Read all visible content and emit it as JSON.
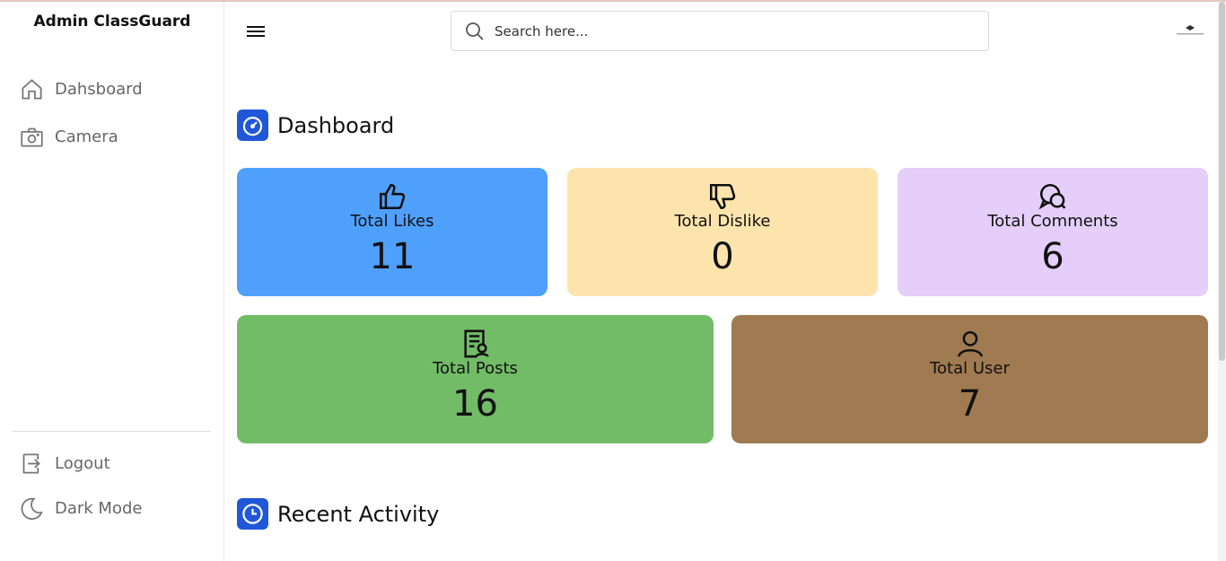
{
  "sidebar": {
    "brand": "Admin ClassGuard",
    "nav": [
      {
        "label": "Dahsboard",
        "icon": "home-icon"
      },
      {
        "label": "Camera",
        "icon": "camera-icon"
      }
    ],
    "bottom": [
      {
        "label": "Logout",
        "icon": "logout-icon"
      },
      {
        "label": "Dark Mode",
        "icon": "moon-icon"
      }
    ]
  },
  "header": {
    "search_placeholder": "Search here..."
  },
  "dashboard": {
    "title": "Dashboard",
    "cards": [
      {
        "label": "Total Likes",
        "value": "11",
        "color": "#4fa0fd",
        "icon": "thumbs-up-icon"
      },
      {
        "label": "Total Dislike",
        "value": "0",
        "color": "#fde4ac",
        "icon": "thumbs-down-icon"
      },
      {
        "label": "Total Comments",
        "value": "6",
        "color": "#e5cefa",
        "icon": "comments-icon"
      },
      {
        "label": "Total Posts",
        "value": "16",
        "color": "#72bc68",
        "icon": "document-icon"
      },
      {
        "label": "Total User",
        "value": "7",
        "color": "#a07a51",
        "icon": "user-icon"
      }
    ]
  },
  "recent": {
    "title": "Recent Activity"
  }
}
